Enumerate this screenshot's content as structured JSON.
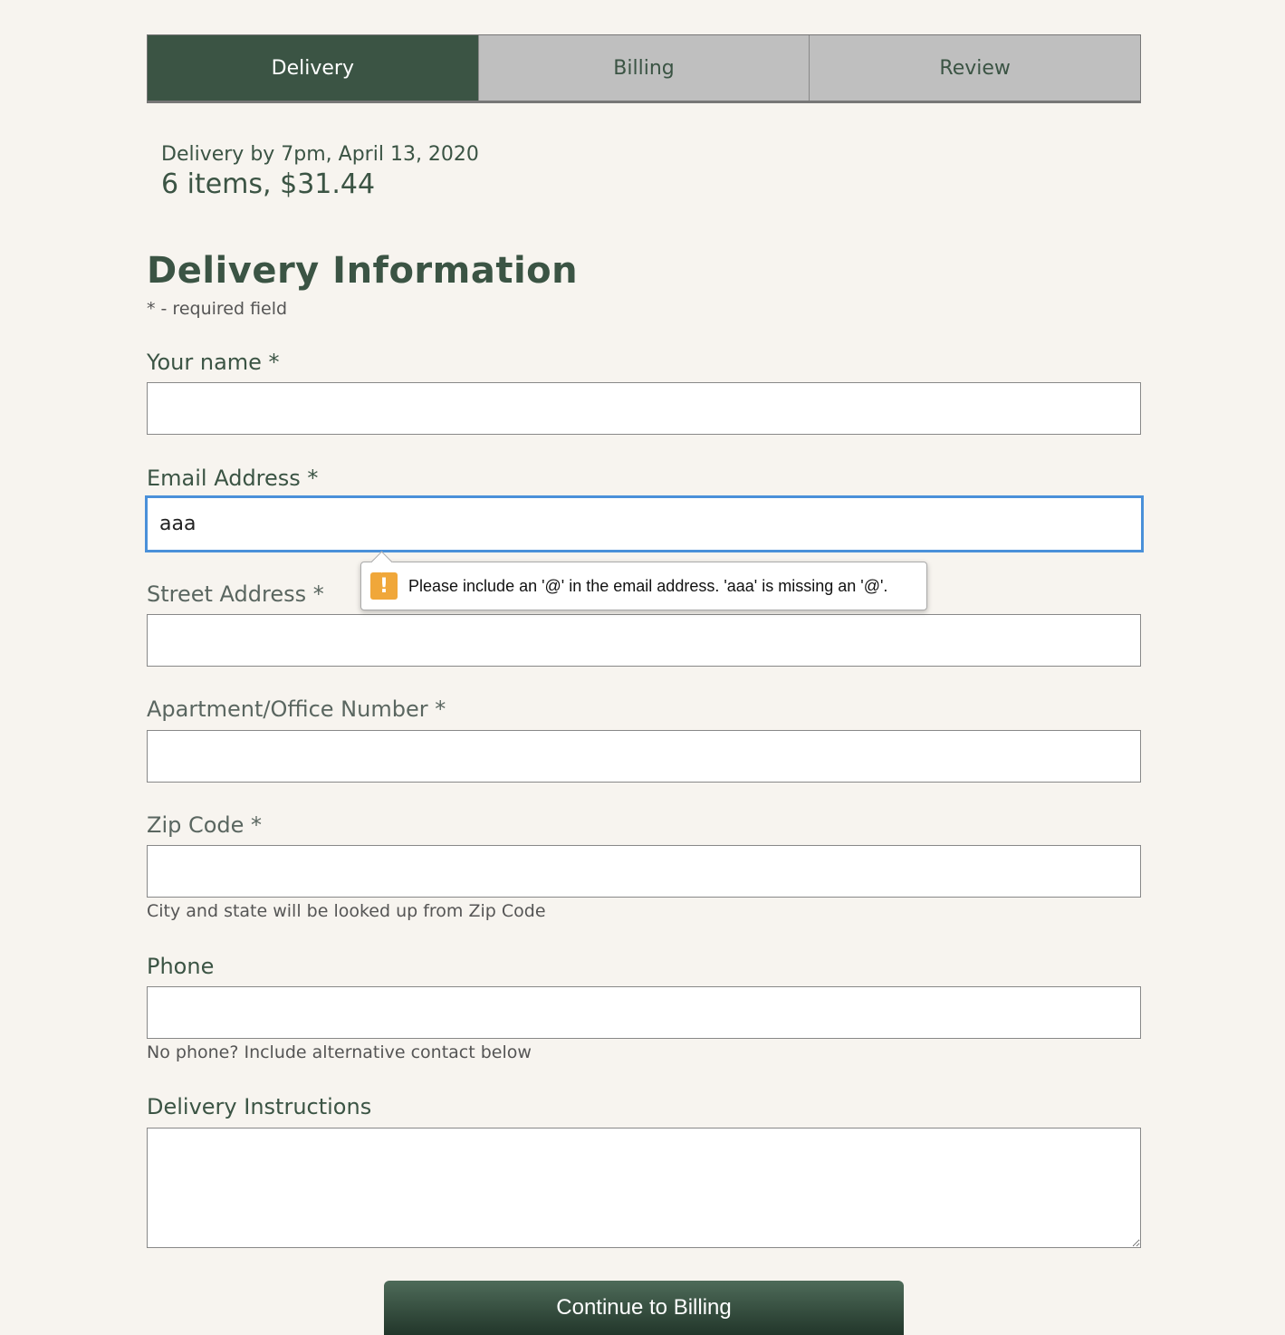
{
  "steps": {
    "delivery": "Delivery",
    "billing": "Billing",
    "review": "Review"
  },
  "summary": {
    "delivery_time": "Delivery by 7pm, April 13, 2020",
    "items_total": "6 items, $31.44"
  },
  "form": {
    "heading": "Delivery Information",
    "required_note": "* - required field",
    "name_label": "Your name *",
    "name_value": "",
    "email_label": "Email Address *",
    "email_value": "aaa",
    "street_label": "Street Address *",
    "street_value": "",
    "apartment_label": "Apartment/Office Number *",
    "apartment_value": "",
    "zip_label": "Zip Code *",
    "zip_value": "",
    "zip_hint": "City and state will be looked up from Zip Code",
    "phone_label": "Phone",
    "phone_value": "",
    "phone_hint": "No phone? Include alternative contact below",
    "instructions_label": "Delivery Instructions",
    "instructions_value": ""
  },
  "validation": {
    "icon": "warning-icon",
    "message": "Please include an '@' in the email address. 'aaa' is missing an '@'."
  },
  "actions": {
    "continue_label": "Continue to Billing"
  },
  "colors": {
    "primary": "#3b5444",
    "background": "#f7f4ef",
    "tab_inactive": "#bfbfbf",
    "focus": "#4a90d9",
    "warning": "#f0a73a"
  }
}
